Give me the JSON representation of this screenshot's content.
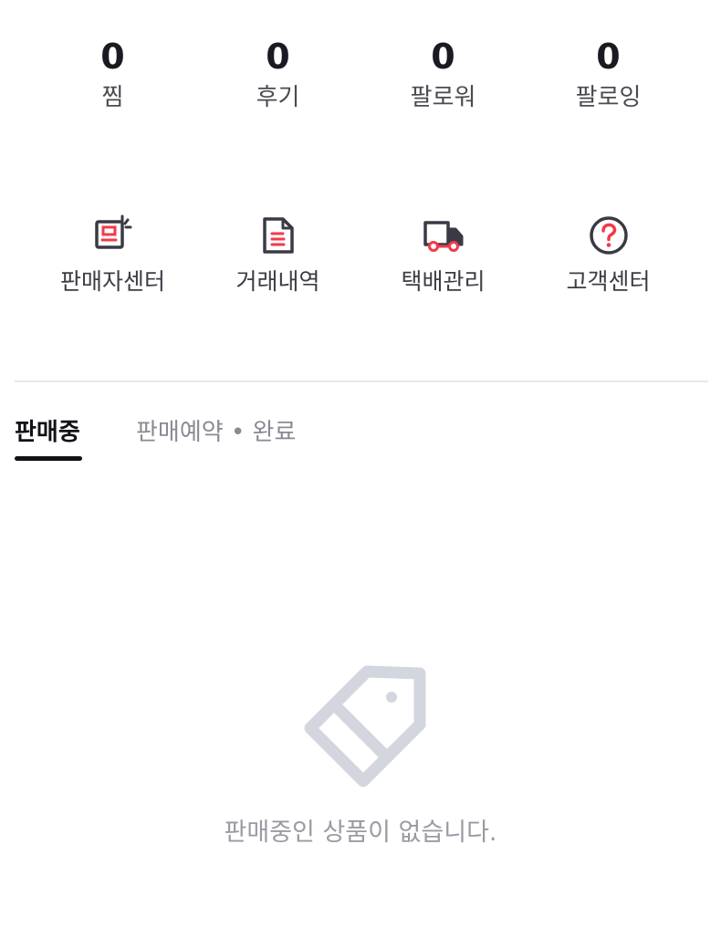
{
  "stats": [
    {
      "count": "0",
      "label": "찜"
    },
    {
      "count": "0",
      "label": "후기"
    },
    {
      "count": "0",
      "label": "팔로워"
    },
    {
      "count": "0",
      "label": "팔로잉"
    }
  ],
  "menu": [
    {
      "label": "판매자센터",
      "icon": "seller-center-icon"
    },
    {
      "label": "거래내역",
      "icon": "document-icon"
    },
    {
      "label": "택배관리",
      "icon": "delivery-truck-icon"
    },
    {
      "label": "고객센터",
      "icon": "question-circle-icon"
    }
  ],
  "tabs": [
    {
      "label": "판매중",
      "selected": true
    },
    {
      "label": "판매예약 • 완료",
      "selected": false
    }
  ],
  "empty_state": {
    "message": "판매중인 상품이 없습니다.",
    "icon": "price-tag-icon"
  },
  "colors": {
    "accent": "#f23a4a",
    "icon_dark": "#3a3a44",
    "text_primary": "#1a1a22",
    "text_muted": "#9a9aa4",
    "tag_gray": "#d3d6de"
  }
}
